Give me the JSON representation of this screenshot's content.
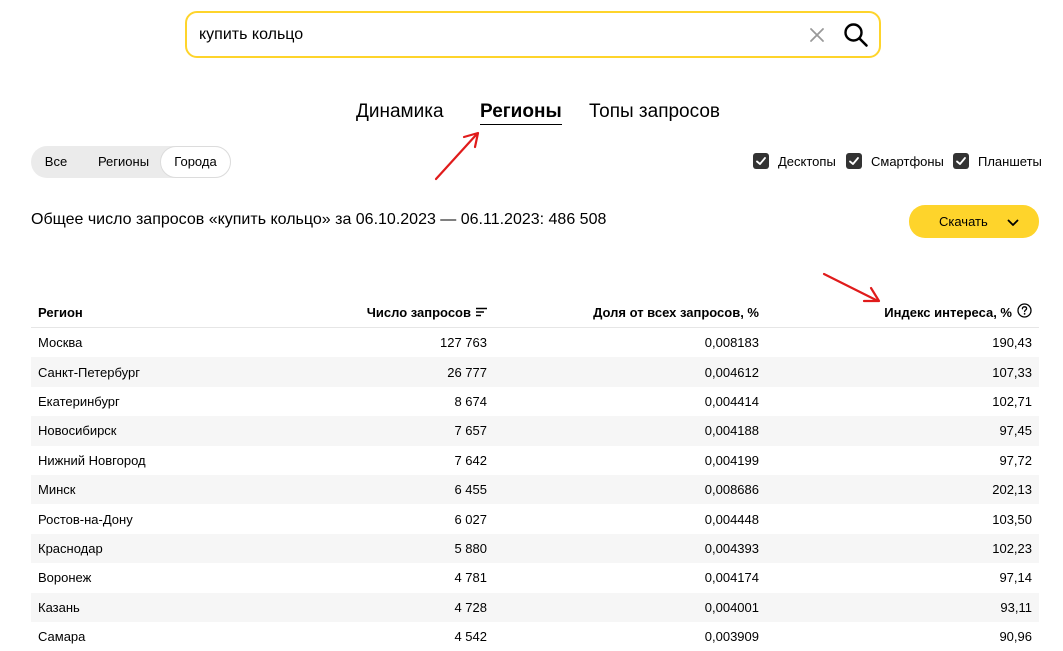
{
  "search": {
    "value": "купить кольцо"
  },
  "tabs": [
    {
      "label": "Динамика"
    },
    {
      "label": "Регионы",
      "active": true
    },
    {
      "label": "Топы запросов"
    }
  ],
  "filters": {
    "segments": [
      {
        "label": "Все"
      },
      {
        "label": "Регионы"
      },
      {
        "label": "Города",
        "selected": true
      }
    ],
    "devices": [
      {
        "label": "Десктопы",
        "checked": true
      },
      {
        "label": "Смартфоны",
        "checked": true
      },
      {
        "label": "Планшеты",
        "checked": true
      }
    ]
  },
  "summary": "Общее число запросов «купить кольцо» за 06.10.2023 — 06.11.2023: 486 508",
  "download_label": "Скачать",
  "table": {
    "headers": [
      "Регион",
      "Число запросов",
      "Доля от всех запросов, %",
      "Индекс интереса, %"
    ],
    "rows": [
      [
        "Москва",
        "127 763",
        "0,008183",
        "190,43"
      ],
      [
        "Санкт-Петербург",
        "26 777",
        "0,004612",
        "107,33"
      ],
      [
        "Екатеринбург",
        "8 674",
        "0,004414",
        "102,71"
      ],
      [
        "Новосибирск",
        "7 657",
        "0,004188",
        "97,45"
      ],
      [
        "Нижний Новгород",
        "7 642",
        "0,004199",
        "97,72"
      ],
      [
        "Минск",
        "6 455",
        "0,008686",
        "202,13"
      ],
      [
        "Ростов-на-Дону",
        "6 027",
        "0,004448",
        "103,50"
      ],
      [
        "Краснодар",
        "5 880",
        "0,004393",
        "102,23"
      ],
      [
        "Воронеж",
        "4 781",
        "0,004174",
        "97,14"
      ],
      [
        "Казань",
        "4 728",
        "0,004001",
        "93,11"
      ],
      [
        "Самара",
        "4 542",
        "0,003909",
        "90,96"
      ]
    ]
  },
  "colors": {
    "accent": "#fed42b",
    "annotation": "#e01b1b",
    "checkbox": "#333333"
  },
  "icons": [
    "close-icon",
    "search-icon",
    "check-icon",
    "chevron-down-icon",
    "sort-icon",
    "help-icon"
  ]
}
